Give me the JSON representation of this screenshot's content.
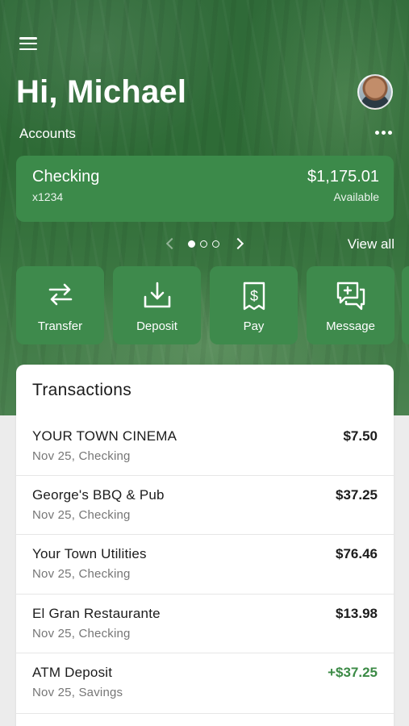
{
  "header": {
    "greeting": "Hi, Michael",
    "menu_icon": "hamburger-menu-icon",
    "avatar_icon": "user-avatar"
  },
  "accounts": {
    "label": "Accounts",
    "more_icon": "more-horizontal-icon",
    "card": {
      "name": "Checking",
      "number": "x1234",
      "balance": "$1,175.01",
      "balance_label": "Available"
    },
    "pager": {
      "total": 3,
      "current": 1
    },
    "view_all": "View all"
  },
  "actions": [
    {
      "label": "Transfer",
      "icon": "transfer-arrows-icon"
    },
    {
      "label": "Deposit",
      "icon": "deposit-download-icon"
    },
    {
      "label": "Pay",
      "icon": "dollar-bill-icon"
    },
    {
      "label": "Message",
      "icon": "message-plus-icon"
    }
  ],
  "transactions": {
    "title": "Transactions",
    "more_icon": "more-horizontal-icon",
    "items": [
      {
        "name": "YOUR TOWN CINEMA",
        "meta": "Nov 25, Checking",
        "amount": "$7.50",
        "credit": false
      },
      {
        "name": "George's BBQ & Pub",
        "meta": "Nov 25, Checking",
        "amount": "$37.25",
        "credit": false
      },
      {
        "name": "Your Town Utilities",
        "meta": "Nov 25, Checking",
        "amount": "$76.46",
        "credit": false
      },
      {
        "name": "El Gran Restaurante",
        "meta": "Nov 25, Checking",
        "amount": "$13.98",
        "credit": false
      },
      {
        "name": "ATM Deposit",
        "meta": "Nov 25, Savings",
        "amount": "+$37.25",
        "credit": true
      }
    ]
  },
  "colors": {
    "brand_green": "#2f6a38",
    "card_green": "#3c8a4a",
    "credit_green": "#3b8a45"
  }
}
